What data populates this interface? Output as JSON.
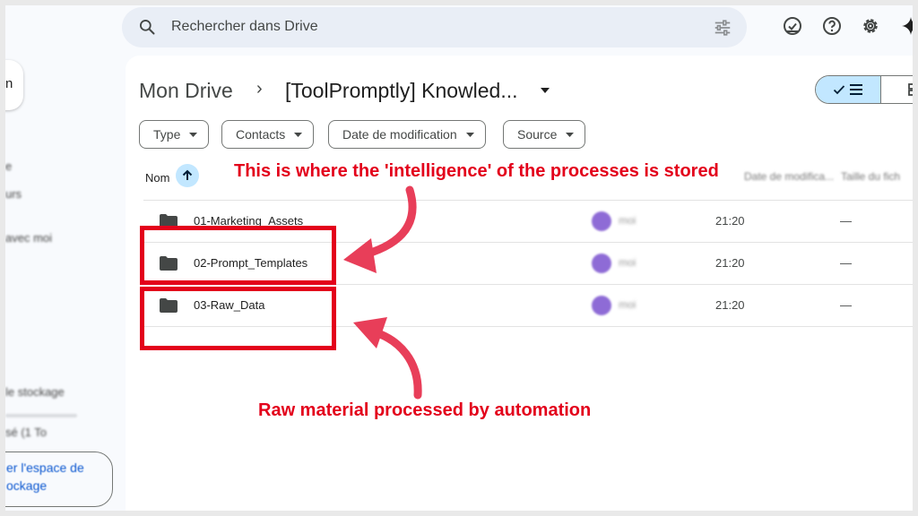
{
  "search": {
    "placeholder": "Rechercher dans Drive"
  },
  "sidebar": {
    "new_label": "n",
    "items": [
      "e",
      "urs",
      "avec moi"
    ],
    "storage_label": "le stockage",
    "storage_usage": "sé (1 To",
    "storage_button_line1": "er l'espace de",
    "storage_button_line2": "ockage"
  },
  "breadcrumb": {
    "root": "Mon Drive",
    "separator": "›",
    "folder": "[ToolPromptly] Knowled..."
  },
  "filters": {
    "type": "Type",
    "contacts": "Contacts",
    "modified": "Date de modification",
    "source": "Source"
  },
  "columns": {
    "name": "Nom",
    "modified": "Date de modifica...",
    "size": "Taille du fich"
  },
  "files": [
    {
      "name": "01-Marketing_Assets",
      "owner": "moi",
      "time": "21:20",
      "size": "—"
    },
    {
      "name": "02-Prompt_Templates",
      "owner": "moi",
      "time": "21:20",
      "size": "—"
    },
    {
      "name": "03-Raw_Data",
      "owner": "moi",
      "time": "21:20",
      "size": "—"
    }
  ],
  "annotations": {
    "top": "This is where the 'intelligence' of the processes is stored",
    "bottom": "Raw material processed by automation",
    "color": "#e3001b"
  }
}
